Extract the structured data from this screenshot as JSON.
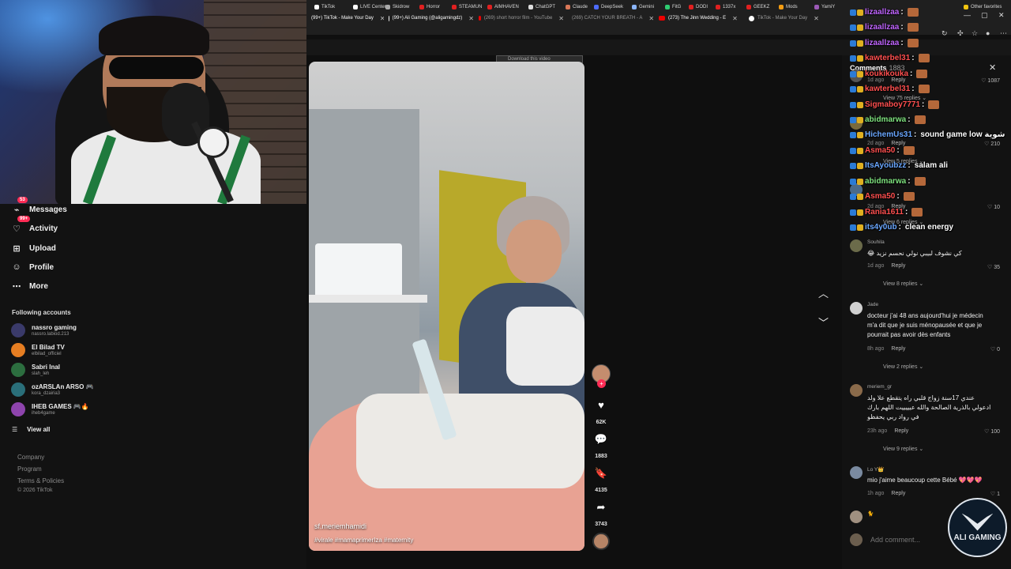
{
  "tabs": [
    {
      "label": "(99+) TikTok - Make Your Day",
      "icon": "tiktok-icon",
      "active": true
    },
    {
      "label": "(99+) Ali Gaming (@aligamingdz)",
      "icon": "tiktok-icon",
      "active": true
    },
    {
      "label": "(269) short horror film - YouTube",
      "icon": "youtube-icon",
      "active": false
    },
    {
      "label": "(269) CATCH YOUR BREATH - A",
      "icon": "youtube-icon",
      "active": false
    },
    {
      "label": "(273) The Jinn Wedding - E",
      "icon": "youtube-icon",
      "active": true
    },
    {
      "label": "TikTok - Make Your Day",
      "icon": "tiktok-icon",
      "active": false
    }
  ],
  "bookmarks": [
    {
      "label": "TikTok",
      "color": "#ffffff"
    },
    {
      "label": "LIVE Center",
      "color": "#ffffff"
    },
    {
      "label": "Skidrow",
      "color": "#aaaaaa"
    },
    {
      "label": "Horror",
      "color": "#e02020"
    },
    {
      "label": "STEAMUN",
      "color": "#e02020"
    },
    {
      "label": "AIMHAVEN",
      "color": "#e02020"
    },
    {
      "label": "ChatGPT",
      "color": "#dddddd"
    },
    {
      "label": "Claude",
      "color": "#d97757"
    },
    {
      "label": "DeepSeek",
      "color": "#4d6bfe"
    },
    {
      "label": "Gemini",
      "color": "#8ab4f8"
    },
    {
      "label": "FitG",
      "color": "#2ecc71"
    },
    {
      "label": "DODI",
      "color": "#e02020"
    },
    {
      "label": "1337x",
      "color": "#e02020"
    },
    {
      "label": "GEEKZ",
      "color": "#e02020"
    },
    {
      "label": "Mods",
      "color": "#f39c12"
    },
    {
      "label": "YamiY",
      "color": "#9b59b6"
    },
    {
      "label": "Other favorites",
      "color": "#f1c40f"
    }
  ],
  "download_bar": "Download this video",
  "sidebar": {
    "nav": [
      {
        "label": "Messages",
        "icon": "messages-icon",
        "badge": "53"
      },
      {
        "label": "Activity",
        "icon": "activity-icon",
        "badge": "99+"
      },
      {
        "label": "Upload",
        "icon": "upload-icon",
        "badge": ""
      },
      {
        "label": "Profile",
        "icon": "profile-icon",
        "badge": ""
      },
      {
        "label": "More",
        "icon": "more-icon",
        "badge": ""
      }
    ],
    "following_title": "Following accounts",
    "accounts": [
      {
        "name": "nassro gaming",
        "handle": "nassro.labiod.213",
        "color": "#3a3a6a"
      },
      {
        "name": "El Bilad TV",
        "handle": "elbilad_officiel",
        "color": "#e67e22"
      },
      {
        "name": "Sabri Inal",
        "handle": "slah_leh",
        "color": "#2c6e3f"
      },
      {
        "name": "ozARSLAn ARSO 🎮",
        "handle": "kora_dzairia3",
        "color": "#2a6f7a"
      },
      {
        "name": "IHEB GAMES 🎮🔥",
        "handle": "iheb4game",
        "color": "#8e44ad"
      }
    ],
    "view_all": "View all",
    "footer": [
      "Company",
      "Program",
      "Terms & Policies",
      "© 2026 TikTok"
    ]
  },
  "video": {
    "author": "sf.meriemhamidi",
    "tags": "#virale #mamaprimerIza #maternity"
  },
  "actions": {
    "likes": "62K",
    "comments": "1883",
    "saves": "4135",
    "shares": "3743"
  },
  "comments_panel": {
    "title": "Comments",
    "count": "1883",
    "items": [
      {
        "user": "",
        "text": "",
        "time": "1d ago",
        "likes": "1087",
        "replies": "View 75 replies",
        "color": "#555"
      },
      {
        "user": "",
        "text": "...",
        "time": "2d ago",
        "likes": "210",
        "replies": "View 5 replies",
        "color": "#7a6a3a"
      },
      {
        "user": "",
        "text": "",
        "time": "2d ago",
        "likes": "10",
        "replies": "View 6 replies",
        "color": "#4a6a8a"
      },
      {
        "user": "Souhila",
        "text": "كي نشوف لبيبي نولي نحسم نزيد 😂",
        "time": "1d ago",
        "likes": "35",
        "replies": "View 8 replies",
        "color": "#6b6b4a"
      },
      {
        "user": "Jade",
        "text": "docteur j'ai 48 ans aujourd'hui je médecin m'a dit que je suis ménopausée et que je pourrait pas avoir dès enfants",
        "time": "8h ago",
        "likes": "0",
        "replies": "View 2 replies",
        "color": "#d0d0d0"
      },
      {
        "user": "meriem_gr",
        "text": "عندي 17سنة زواج قلبي راه يتقطع علا ولد ادعولي بالذرية الصالحة والله عيييييت اللهم بارك في رواد ربي يحفظو",
        "time": "23h ago",
        "likes": "100",
        "replies": "View 9 replies",
        "color": "#8a6a4a"
      },
      {
        "user": "Lo Y👑",
        "text": "mio j'aime beaucoup cette Bébé 💖💖💖",
        "time": "1h ago",
        "likes": "1",
        "replies": "",
        "color": "#7a8aa0"
      },
      {
        "user": "🐈",
        "text": "",
        "time": "",
        "likes": "",
        "replies": "",
        "color": "#a09080"
      }
    ],
    "reply_label": "Reply",
    "add_comment_placeholder": "Add comment..."
  },
  "chat": [
    {
      "user": "lizaallzaa",
      "msg": "",
      "color": "#c065ff"
    },
    {
      "user": "lizaallzaa",
      "msg": "",
      "color": "#c065ff"
    },
    {
      "user": "lizaallzaa",
      "msg": "",
      "color": "#c065ff"
    },
    {
      "user": "kawterbel31",
      "msg": "",
      "color": "#ff4f4f"
    },
    {
      "user": "koukikouka",
      "msg": "",
      "color": "#ff4f4f"
    },
    {
      "user": "kawterbel31",
      "msg": "",
      "color": "#ff4f4f"
    },
    {
      "user": "Sigmaboy7771",
      "msg": "",
      "color": "#ff4f4f"
    },
    {
      "user": "abidmarwa",
      "msg": "",
      "color": "#7ee27e"
    },
    {
      "user": "HichemUs31",
      "msg": "sound game low شوية",
      "color": "#6aa7ff"
    },
    {
      "user": "Asma50",
      "msg": "",
      "color": "#ff4f4f"
    },
    {
      "user": "ItsAyoubzz",
      "msg": "salam ali",
      "color": "#6aa7ff"
    },
    {
      "user": "abidmarwa",
      "msg": "",
      "color": "#7ee27e"
    },
    {
      "user": "Asma50",
      "msg": "",
      "color": "#ff4f4f"
    },
    {
      "user": "Rania1611",
      "msg": "",
      "color": "#ff4f4f"
    },
    {
      "user": "its4y0ub",
      "msg": "clean energy",
      "color": "#6aa7ff"
    }
  ],
  "logo_text": "ALI GAMING"
}
